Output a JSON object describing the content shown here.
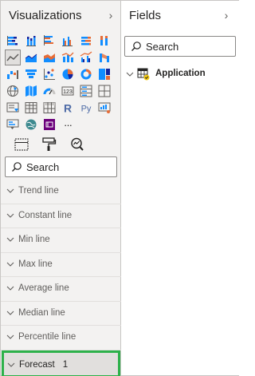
{
  "visualizations": {
    "title": "Visualizations",
    "collapse_glyph": "›",
    "icons": [
      {
        "name": "stacked-bar-chart-icon",
        "selected": false
      },
      {
        "name": "stacked-column-chart-icon",
        "selected": false
      },
      {
        "name": "clustered-bar-chart-icon",
        "selected": false
      },
      {
        "name": "clustered-column-chart-icon",
        "selected": false
      },
      {
        "name": "100-stacked-bar-chart-icon",
        "selected": false
      },
      {
        "name": "100-stacked-column-chart-icon",
        "selected": false
      },
      {
        "name": "line-chart-icon",
        "selected": true
      },
      {
        "name": "area-chart-icon",
        "selected": false
      },
      {
        "name": "stacked-area-chart-icon",
        "selected": false
      },
      {
        "name": "line-and-stacked-column-chart-icon",
        "selected": false
      },
      {
        "name": "line-and-clustered-column-chart-icon",
        "selected": false
      },
      {
        "name": "ribbon-chart-icon",
        "selected": false
      },
      {
        "name": "waterfall-chart-icon",
        "selected": false
      },
      {
        "name": "funnel-chart-icon",
        "selected": false
      },
      {
        "name": "scatter-chart-icon",
        "selected": false
      },
      {
        "name": "pie-chart-icon",
        "selected": false
      },
      {
        "name": "donut-chart-icon",
        "selected": false
      },
      {
        "name": "treemap-icon",
        "selected": false
      },
      {
        "name": "map-icon",
        "selected": false
      },
      {
        "name": "filled-map-icon",
        "selected": false
      },
      {
        "name": "gauge-icon",
        "selected": false
      },
      {
        "name": "card-icon",
        "selected": false
      },
      {
        "name": "multi-row-card-icon",
        "selected": false
      },
      {
        "name": "kpi-icon",
        "selected": false
      },
      {
        "name": "slicer-icon",
        "selected": false
      },
      {
        "name": "table-icon",
        "selected": false
      },
      {
        "name": "matrix-icon",
        "selected": false
      },
      {
        "name": "r-script-visual-icon",
        "selected": false
      },
      {
        "name": "python-visual-icon",
        "selected": false
      },
      {
        "name": "key-influencers-icon",
        "selected": false
      },
      {
        "name": "decomposition-tree-icon",
        "selected": false
      },
      {
        "name": "arcgis-map-icon",
        "selected": false
      },
      {
        "name": "power-apps-icon",
        "selected": false
      },
      {
        "name": "more-visuals-icon",
        "selected": false
      }
    ],
    "icon_glyphs": {
      "r": "R",
      "py": "Py",
      "more": "···"
    },
    "tabs": [
      {
        "name": "tab-fields",
        "active": false
      },
      {
        "name": "tab-format",
        "active": false
      },
      {
        "name": "tab-analytics",
        "active": true
      }
    ],
    "search": {
      "placeholder": "Search",
      "value": ""
    },
    "sections": [
      {
        "label": "Trend line",
        "count": ""
      },
      {
        "label": "Constant line",
        "count": ""
      },
      {
        "label": "Min line",
        "count": ""
      },
      {
        "label": "Max line",
        "count": ""
      },
      {
        "label": "Average line",
        "count": ""
      },
      {
        "label": "Median line",
        "count": ""
      },
      {
        "label": "Percentile line",
        "count": ""
      },
      {
        "label": "Forecast",
        "count": "1",
        "highlighted": true
      }
    ]
  },
  "fields": {
    "title": "Fields",
    "collapse_glyph": "›",
    "search": {
      "placeholder": "Search",
      "value": ""
    },
    "tables": [
      {
        "label": "Application",
        "expanded": false
      }
    ]
  },
  "colors": {
    "accent_yellow": "#f2c811",
    "highlight_green": "#2db14a",
    "chart_blue": "#118dff",
    "chart_navy": "#12239e",
    "chart_orange": "#e66c37",
    "chart_purple": "#6b007b",
    "chart_teal": "#3d8a8f"
  }
}
